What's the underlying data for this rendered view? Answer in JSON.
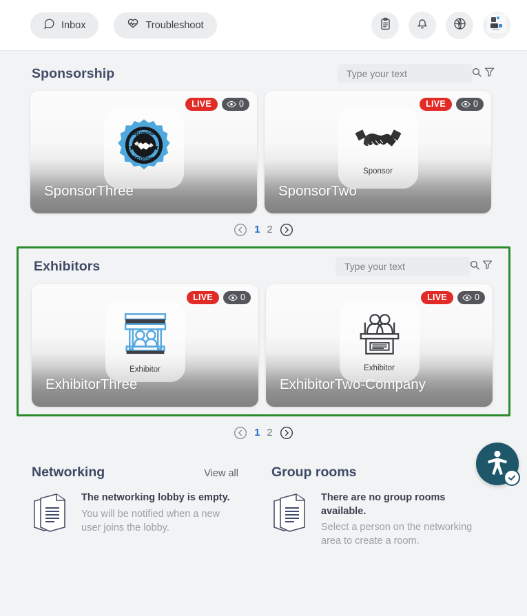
{
  "topbar": {
    "inbox_label": "Inbox",
    "troubleshoot_label": "Troubleshoot",
    "icons": [
      "chat-bubble-icon",
      "heart-pulse-icon",
      "clipboard-icon",
      "bell-icon",
      "globe-icon",
      "avatar-thumbnail"
    ]
  },
  "sponsorship": {
    "title": "Sponsorship",
    "search_placeholder": "Type your text",
    "search_value": "",
    "cards": [
      {
        "name": "SponsorThree",
        "live_label": "LIVE",
        "views": "0",
        "logo_caption": "",
        "logo_type": "sponsor-badge-logo"
      },
      {
        "name": "SponsorTwo",
        "live_label": "LIVE",
        "views": "0",
        "logo_caption": "Sponsor",
        "logo_type": "handshake-logo"
      }
    ],
    "pagination": {
      "prev": "‹",
      "next": "›",
      "pages": [
        "1",
        "2"
      ],
      "current": "1"
    }
  },
  "exhibitors": {
    "title": "Exhibitors",
    "search_placeholder": "Type your text",
    "search_value": "",
    "highlight_color": "#2a8b2a",
    "cards": [
      {
        "name": "ExhibitorThree",
        "live_label": "LIVE",
        "views": "0",
        "logo_caption": "Exhibitor",
        "logo_type": "booth-blue-logo"
      },
      {
        "name": "ExhibitorTwo-Company",
        "live_label": "LIVE",
        "views": "0",
        "logo_caption": "Exhibitor",
        "logo_type": "booth-dark-logo"
      }
    ],
    "pagination": {
      "prev": "‹",
      "next": "›",
      "pages": [
        "1",
        "2"
      ],
      "current": "1"
    }
  },
  "networking": {
    "title": "Networking",
    "view_all_label": "View all",
    "empty_heading": "The networking lobby is empty.",
    "empty_body": "You will be notified when a new user joins the lobby."
  },
  "group_rooms": {
    "title": "Group rooms",
    "empty_heading": "There are no group rooms available.",
    "empty_body": "Select a person on the networking area to create a room."
  },
  "accessibility": {
    "icon": "accessibility-person-icon",
    "color": "#1e566a"
  },
  "colors": {
    "accent_blue": "#1669c7",
    "title_navy": "#3f4a66",
    "live_red": "#e02b27",
    "highlight_green": "#2a8b2a"
  }
}
